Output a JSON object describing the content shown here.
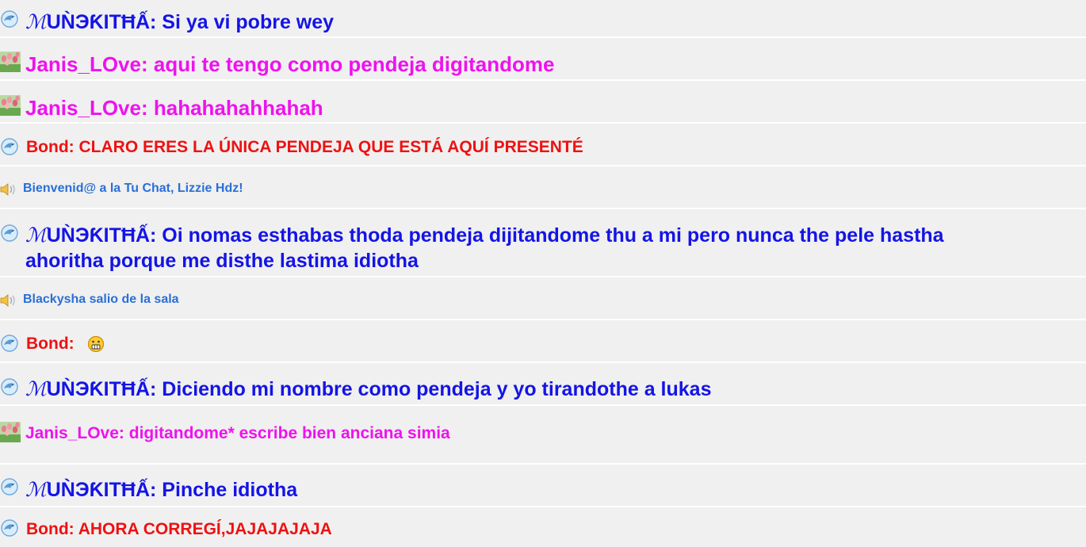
{
  "colors": {
    "muneqitha": "#1414e6",
    "janis": "#ee12ee",
    "bond": "#ee1111",
    "system": "#2a6fd6",
    "row_bg": "#f0f0f0",
    "divider": "#ffffff"
  },
  "messages": [
    {
      "icon": "dolphin-icon",
      "user_m": "ℳ",
      "user_rest": "UǸЭƘITĦẤ:",
      "text": " Si ya vi pobre wey"
    },
    {
      "icon": "tulips-icon",
      "user": "Janis_LOve:",
      "text": " aqui te tengo como pendeja digitandome"
    },
    {
      "icon": "tulips-icon",
      "user": "Janis_LOve:",
      "text": " hahahahahhahah"
    },
    {
      "icon": "dolphin-icon",
      "user": "Bond:",
      "text": " CLARO ERES LA ÚNICA PENDEJA QUE ESTÁ AQUÍ PRESENTÉ"
    },
    {
      "icon": "speaker-icon",
      "text": "Bienvenid@ a la Tu Chat, Lizzie Hdz!"
    },
    {
      "icon": "dolphin-icon",
      "user_m": "ℳ",
      "user_rest": "UǸЭƘITĦẤ:",
      "text": " Oi nomas esthabas thoda pendeja dijitandome thu a mi pero nunca the pele hastha",
      "text2": "ahoritha porque me disthe lastima idiotha"
    },
    {
      "icon": "speaker-icon",
      "text": "Blackysha salio de la sala"
    },
    {
      "icon": "dolphin-icon",
      "user": "Bond:",
      "emoticon": "grimace-emoticon-icon"
    },
    {
      "icon": "dolphin-icon",
      "user_m": "ℳ",
      "user_rest": "UǸЭƘITĦẤ:",
      "text": " Diciendo mi nombre como pendeja y yo tirandothe a lukas"
    },
    {
      "icon": "tulips-icon",
      "user": "Janis_LOve:",
      "text": " digitandome* escribe bien anciana simia"
    },
    {
      "icon": "dolphin-icon",
      "user_m": "ℳ",
      "user_rest": "UǸЭƘITĦẤ:",
      "text": " Pinche idiotha"
    },
    {
      "icon": "dolphin-icon",
      "user": "Bond:",
      "text": " AHORA CORREGÍ,JAJAJAJAJA"
    }
  ]
}
